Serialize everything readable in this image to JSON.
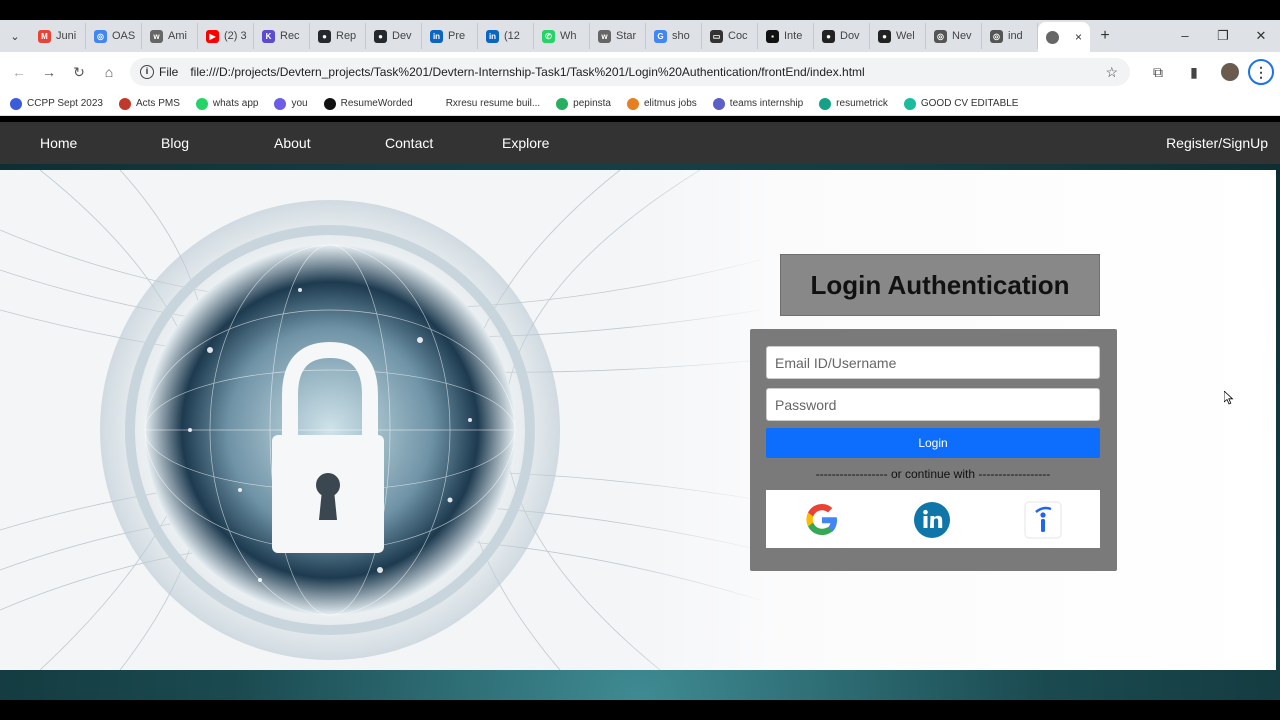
{
  "browser": {
    "tabs": [
      {
        "label": "Juni",
        "icon": "gmail-icon",
        "color": "#ea4335",
        "glyph": "M"
      },
      {
        "label": "OAS",
        "icon": "chrome-icon",
        "color": "#4285f4",
        "glyph": "◎"
      },
      {
        "label": "Ami",
        "icon": "wiki-icon",
        "color": "#666666",
        "glyph": "w"
      },
      {
        "label": "(2) 3",
        "icon": "youtube-icon",
        "color": "#ff0000",
        "glyph": "▶"
      },
      {
        "label": "Rec",
        "icon": "react-icon",
        "color": "#5b4bd1",
        "glyph": "K"
      },
      {
        "label": "Rep",
        "icon": "github-icon",
        "color": "#24292e",
        "glyph": "●"
      },
      {
        "label": "Dev",
        "icon": "github-icon",
        "color": "#24292e",
        "glyph": "●"
      },
      {
        "label": "Pre",
        "icon": "linkedin-icon",
        "color": "#0a66c2",
        "glyph": "in"
      },
      {
        "label": "(12",
        "icon": "linkedin-icon",
        "color": "#0a66c2",
        "glyph": "in"
      },
      {
        "label": "Wh",
        "icon": "whatsapp-icon",
        "color": "#25d366",
        "glyph": "✆"
      },
      {
        "label": "Star",
        "icon": "wiki-icon",
        "color": "#666666",
        "glyph": "w"
      },
      {
        "label": "sho",
        "icon": "google-icon",
        "color": "#4285f4",
        "glyph": "G"
      },
      {
        "label": "Coc",
        "icon": "code-icon",
        "color": "#333333",
        "glyph": "▭"
      },
      {
        "label": "Inte",
        "icon": "terminal-icon",
        "color": "#111111",
        "glyph": "▪"
      },
      {
        "label": "Dov",
        "icon": "globe-icon",
        "color": "#222222",
        "glyph": "●"
      },
      {
        "label": "Wel",
        "icon": "globe-icon",
        "color": "#222222",
        "glyph": "●"
      },
      {
        "label": "Nev",
        "icon": "globe-icon",
        "color": "#555555",
        "glyph": "◎"
      },
      {
        "label": "ind",
        "icon": "globe-icon",
        "color": "#555555",
        "glyph": "◎"
      }
    ],
    "active_tab": {
      "icon": "globe-icon",
      "close": "×"
    },
    "new_tab": "+",
    "window_controls": {
      "minimize": "–",
      "restore": "❐",
      "close": "✕"
    },
    "nav": {
      "back": "←",
      "forward": "→",
      "reload": "↻",
      "home": "⌂"
    },
    "omnibox": {
      "chip": "File",
      "url": "file:///D:/projects/Devtern_projects/Task%201/Devtern-Internship-Task1/Task%201/Login%20Authentication/frontEnd/index.html"
    },
    "bookmarks": [
      {
        "label": "CCPP Sept 2023",
        "color": "#3b5bdb"
      },
      {
        "label": "Acts PMS",
        "color": "#c0392b"
      },
      {
        "label": "whats app",
        "color": "#25d366"
      },
      {
        "label": "you",
        "color": "#6c5ce7"
      },
      {
        "label": "ResumeWorded",
        "color": "#111111"
      },
      {
        "label": "Rxresu resume buil...",
        "color": "#ffffff"
      },
      {
        "label": "pepinsta",
        "color": "#27ae60"
      },
      {
        "label": "elitmus jobs",
        "color": "#e67e22"
      },
      {
        "label": "teams internship",
        "color": "#5b5fc7"
      },
      {
        "label": "resumetrick",
        "color": "#16a085"
      },
      {
        "label": "GOOD CV EDITABLE",
        "color": "#1abc9c"
      }
    ]
  },
  "site": {
    "nav": {
      "home": "Home",
      "blog": "Blog",
      "about": "About",
      "contact": "Contact",
      "explore": "Explore",
      "register": "Register/SignUp"
    },
    "login": {
      "title": "Login Authentication",
      "email_placeholder": "Email ID/Username",
      "password_placeholder": "Password",
      "button": "Login",
      "divider": "------------------ or continue with ------------------"
    },
    "social": [
      {
        "name": "google",
        "icon": "google-logo-icon",
        "color": "#4285f4"
      },
      {
        "name": "linkedin",
        "icon": "linkedin-logo-icon",
        "color": "#0e76a8"
      },
      {
        "name": "indeed",
        "icon": "indeed-logo-icon",
        "color": "#2164f3"
      }
    ]
  }
}
